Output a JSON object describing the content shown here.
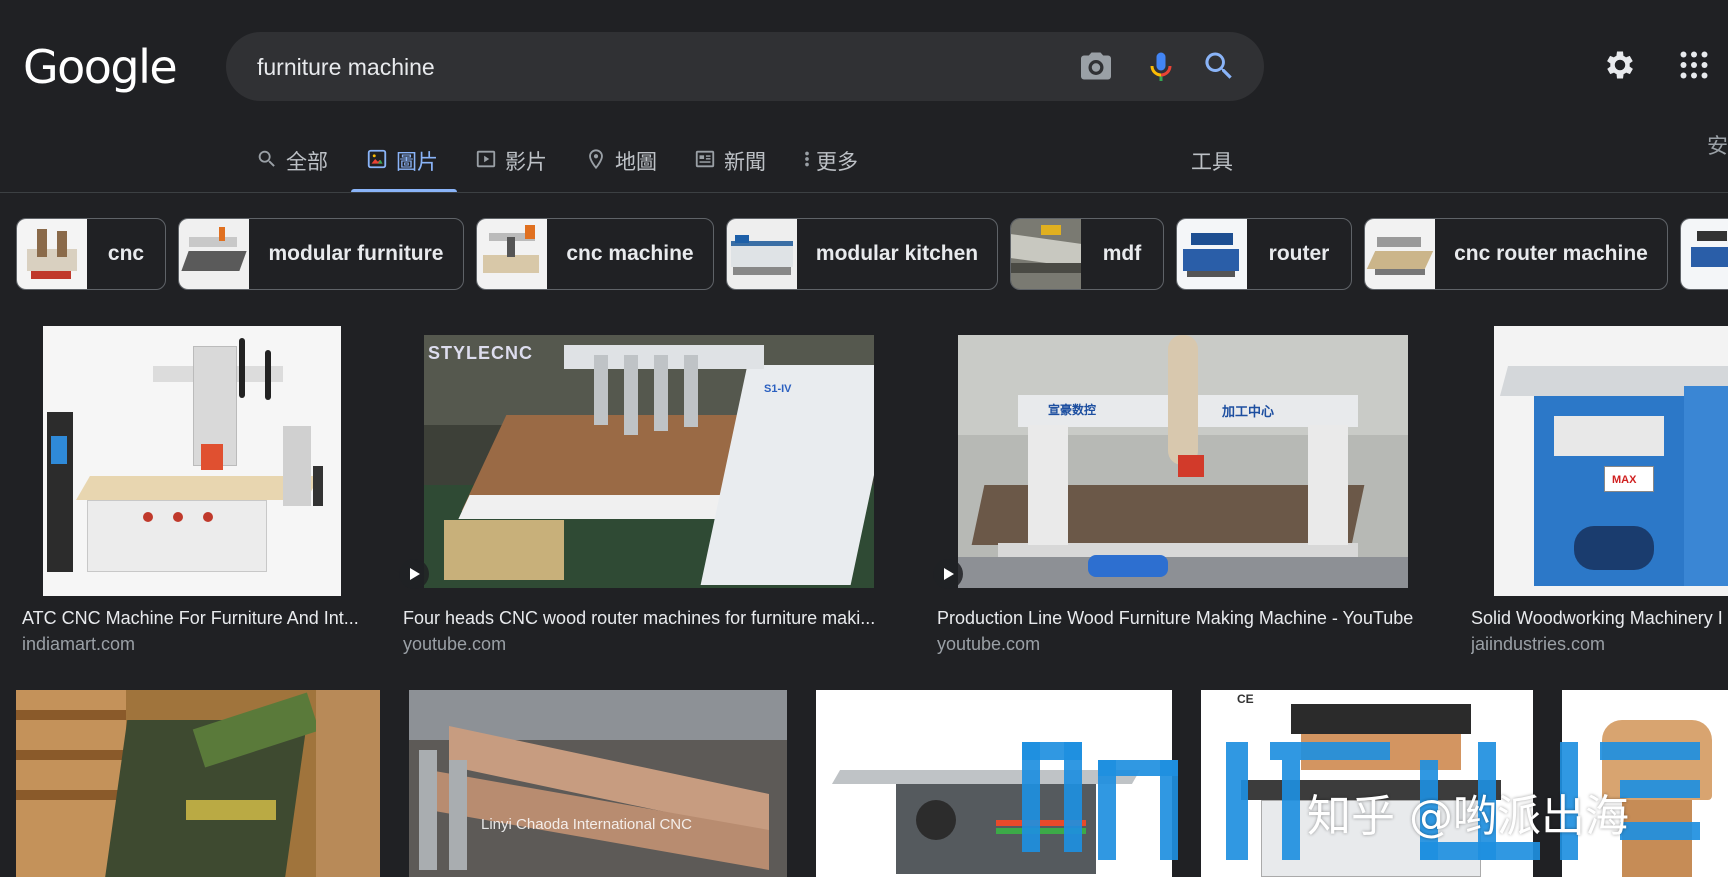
{
  "header": {
    "logo_text": "Google",
    "search_value": "furniture machine",
    "icons": [
      "camera-icon",
      "microphone-icon",
      "search-icon",
      "settings-icon",
      "apps-grid-icon"
    ]
  },
  "tabs": [
    {
      "label": "全部",
      "icon": "search-icon",
      "active": false
    },
    {
      "label": "圖片",
      "icon": "image-icon",
      "active": true
    },
    {
      "label": "影片",
      "icon": "video-icon",
      "active": false
    },
    {
      "label": "地圖",
      "icon": "map-pin-icon",
      "active": false
    },
    {
      "label": "新聞",
      "icon": "news-icon",
      "active": false
    },
    {
      "label": "更多",
      "icon": "more-vert-icon",
      "active": false
    }
  ],
  "tools_label": "工具",
  "edge_text": "安",
  "chips": [
    {
      "label": "cnc"
    },
    {
      "label": "modular furniture"
    },
    {
      "label": "cnc machine"
    },
    {
      "label": "modular kitchen"
    },
    {
      "label": "mdf"
    },
    {
      "label": "router"
    },
    {
      "label": "cnc router machine"
    }
  ],
  "results": [
    {
      "title": "ATC CNC Machine For Furniture And Int...",
      "source": "indiamart.com",
      "video": false
    },
    {
      "title": "Four heads CNC wood router machines for furniture maki...",
      "source": "youtube.com",
      "video": true
    },
    {
      "title": "Production Line Wood Furniture Making Machine - YouTube",
      "source": "youtube.com",
      "video": true
    },
    {
      "title": "Solid Woodworking Machinery I",
      "source": "jaiindustries.com",
      "video": false
    }
  ],
  "image_text": {
    "styleCNC": "STYLECNC",
    "s1iv": "S1-IV",
    "cn_label": "加工中心",
    "cn_label2": "宣豪数控",
    "max": "MAX",
    "chaoda": "Linyi Chaoda International CNC",
    "ce": "CE"
  },
  "watermark": "知乎 @哟派出海",
  "colors": {
    "background": "#202124",
    "searchbox": "#303134",
    "accent": "#8ab4f8",
    "text": "#e8eaed",
    "muted": "#9aa0a6"
  }
}
